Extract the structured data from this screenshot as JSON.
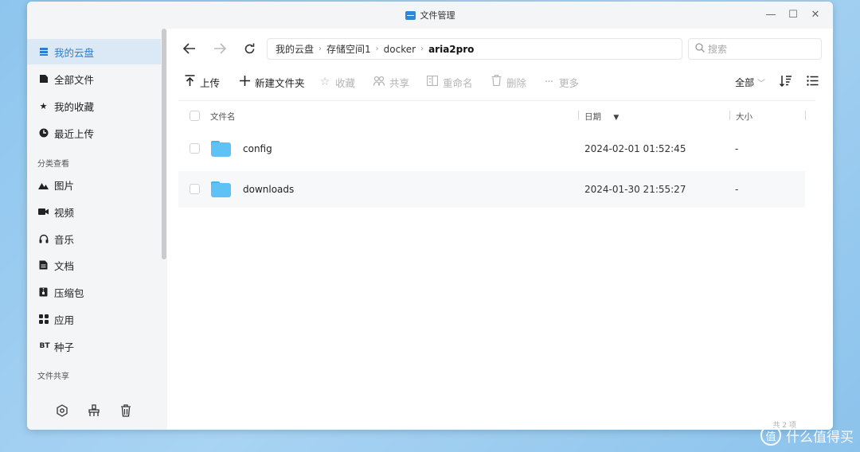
{
  "window": {
    "title": "文件管理",
    "controls": {
      "minimize": "—",
      "maximize": "☐",
      "close": "✕"
    }
  },
  "sidebar": {
    "items": [
      {
        "label": "我的云盘",
        "icon": "storage-icon",
        "active": true
      },
      {
        "label": "全部文件",
        "icon": "file-icon"
      },
      {
        "label": "我的收藏",
        "icon": "star-icon"
      },
      {
        "label": "最近上传",
        "icon": "clock-icon"
      }
    ],
    "category_section": "分类查看",
    "categories": [
      {
        "label": "图片",
        "icon": "image-icon"
      },
      {
        "label": "视频",
        "icon": "video-icon"
      },
      {
        "label": "音乐",
        "icon": "headphones-icon"
      },
      {
        "label": "文档",
        "icon": "document-icon"
      },
      {
        "label": "压缩包",
        "icon": "archive-icon"
      },
      {
        "label": "应用",
        "icon": "apps-icon"
      },
      {
        "label": "种子",
        "icon": "bt-icon",
        "icon_text": "BT"
      }
    ],
    "share_section": "文件共享",
    "bottom_icons": [
      "settings-hex-icon",
      "clean-icon",
      "trash-icon"
    ]
  },
  "nav": {
    "breadcrumb": [
      "我的云盘",
      "存储空间1",
      "docker",
      "aria2pro"
    ],
    "search_placeholder": "搜索"
  },
  "toolbar": {
    "upload": "上传",
    "new_folder": "新建文件夹",
    "favorite": "收藏",
    "share": "共享",
    "rename": "重命名",
    "delete": "删除",
    "more": "更多",
    "filter": "全部"
  },
  "list": {
    "headers": {
      "name": "文件名",
      "date": "日期",
      "size": "大小"
    },
    "rows": [
      {
        "name": "config",
        "date": "2024-02-01 01:52:45",
        "size": "-"
      },
      {
        "name": "downloads",
        "date": "2024-01-30 21:55:27",
        "size": "-"
      }
    ]
  },
  "watermark": {
    "text": "什么值得买",
    "small": "共 2 项"
  },
  "colors": {
    "accent": "#2f7dd1",
    "folder": "#5ec2f6",
    "desktop": "#9ccdf1"
  }
}
